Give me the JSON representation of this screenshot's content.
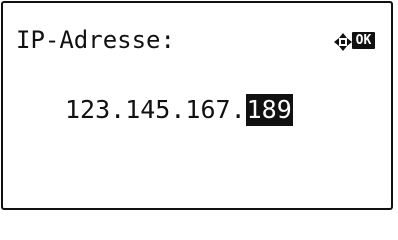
{
  "screen": {
    "title": "IP-Adresse:",
    "ok_label": "OK",
    "nav_icon": "four-way-arrow-icon"
  },
  "ip_address": {
    "prefix": "123.145.167.",
    "active_octet": "189"
  }
}
